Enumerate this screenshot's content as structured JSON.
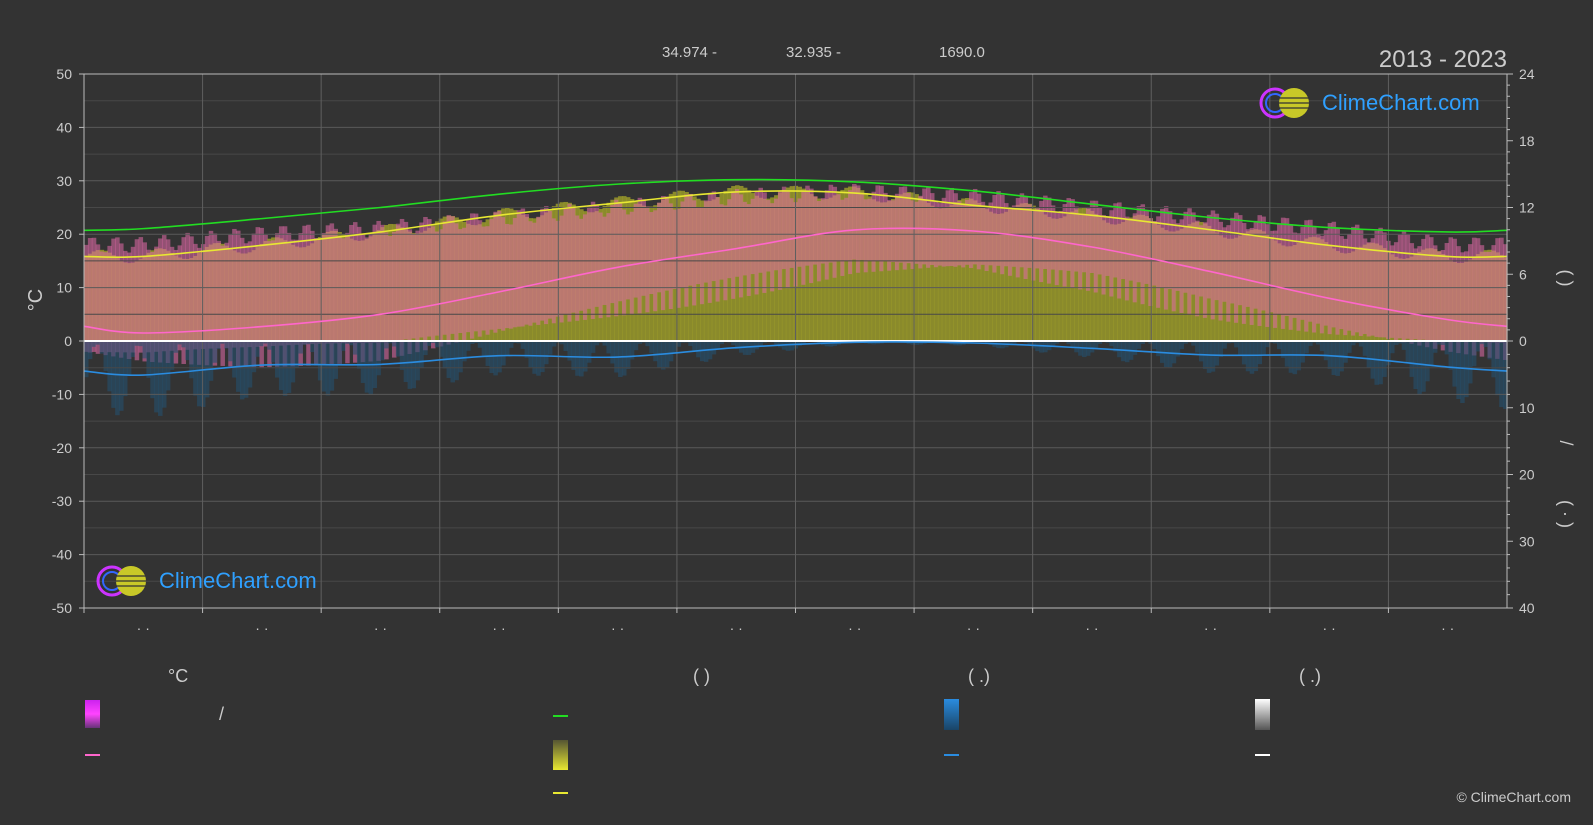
{
  "header": {
    "period": "2013 - 2023",
    "coord_lat": "34.974 -",
    "coord_lon": "32.935 -",
    "elevation": "1690.0"
  },
  "logo": {
    "text": "ClimeChart.com"
  },
  "copyright": "© ClimeChart.com",
  "legend": {
    "col1_head": "°C",
    "col1_slash": "/",
    "col2_head": "(            )",
    "col3_head": "(    .)",
    "col4_head": "(    .)"
  },
  "colors": {
    "background": "#333333",
    "max_temp_line": "#22dd22",
    "daylight_line": "#22dd22",
    "sunshine_line": "#e8e832",
    "mean_temp_line": "#ff66cc",
    "rain_line": "#2a8ce0",
    "temp_fill": "#e26aa8",
    "sun_fill": "#9a9a2a",
    "zero_line": "#ffffff"
  },
  "chart_data": {
    "type": "line",
    "x_tick_labels": [
      "· ·",
      "· ·",
      "· ·",
      "· ·",
      "· ·",
      "· ·",
      "· ·",
      "· ·",
      "· ·",
      "· ·",
      "· ·",
      "· ·"
    ],
    "ylabel_left": "°C",
    "ylim_left": [
      -50,
      50
    ],
    "yticks_left": [
      50,
      40,
      30,
      20,
      10,
      0,
      -10,
      -20,
      -30,
      -40,
      -50
    ],
    "ylim_right_top": [
      0,
      24
    ],
    "yticks_right_top": [
      24,
      18,
      12,
      6,
      0
    ],
    "ylim_right_bottom": [
      0,
      40
    ],
    "yticks_right_bottom": [
      0,
      10,
      20,
      30,
      40
    ],
    "right_label_top": "(    )",
    "right_label_bottom": "/",
    "right_label_bottom2": "( · )",
    "grid": true,
    "series": [
      {
        "key": "daylight",
        "unit": "hours",
        "values": [
          10.1,
          11.0,
          12.0,
          13.2,
          14.1,
          14.5,
          14.3,
          13.5,
          12.3,
          11.1,
          10.2,
          9.8
        ]
      },
      {
        "key": "sunshine",
        "unit": "hours",
        "values": [
          7.6,
          8.6,
          9.8,
          11.3,
          12.4,
          13.4,
          13.3,
          12.2,
          11.3,
          10.0,
          8.6,
          7.6
        ]
      },
      {
        "key": "mean_temp",
        "unit": "°C",
        "values": [
          1.5,
          2.7,
          5.0,
          9.2,
          13.8,
          17.3,
          20.8,
          20.6,
          17.6,
          13.0,
          8.0,
          4.0
        ]
      },
      {
        "key": "max_temp_band_top",
        "unit": "°C",
        "values": [
          18,
          20,
          21,
          23,
          25,
          27,
          28,
          27,
          25,
          23,
          21,
          18
        ]
      },
      {
        "key": "min_temp_band_bottom",
        "unit": "°C",
        "values": [
          -3,
          -3,
          -2,
          2,
          6,
          10,
          14,
          14,
          11,
          6,
          2,
          -1
        ]
      },
      {
        "key": "rain",
        "unit": "mm",
        "values": [
          5.1,
          3.6,
          3.5,
          2.2,
          2.4,
          1.0,
          0.2,
          0.3,
          1.1,
          2.1,
          2.2,
          3.9
        ]
      }
    ]
  }
}
